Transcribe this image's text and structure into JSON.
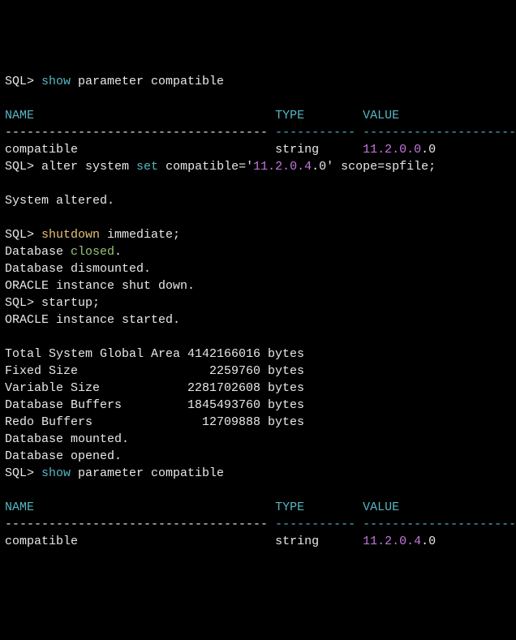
{
  "lines": {
    "cmd1_prompt": "SQL> ",
    "cmd1_keyword": "show",
    "cmd1_rest": " parameter compatible",
    "blank1": "",
    "hdr1_name": "NAME                                 ",
    "hdr1_type": "TYPE        ",
    "hdr1_value": "VALUE",
    "dash1a": "------------------------------------ ",
    "dash1b": "----------- ",
    "dash1c": "------------------------------",
    "row1_name": "compatible                           ",
    "row1_type": "string      ",
    "row1_val_a": "11.2.0.0",
    "row1_val_b": ".0",
    "cmd2_prompt": "SQL> ",
    "cmd2_a": "alter system ",
    "cmd2_b": "set",
    "cmd2_c": " compatible=",
    "cmd2_q1": "'",
    "cmd2_val": "11.2.0.4",
    "cmd2_valrest": ".0",
    "cmd2_q2": "'",
    "cmd2_d": " scope=spfile;",
    "blank2": "",
    "sysaltered": "System altered.",
    "blank3": "",
    "cmd3_prompt": "SQL> ",
    "cmd3_a": "shutdown",
    "cmd3_b": " immediate;",
    "db_closed_a": "Database ",
    "db_closed_b": "closed",
    "db_closed_c": ".",
    "db_dism": "Database dismounted.",
    "inst_shut": "ORACLE instance shut down.",
    "cmd4_prompt": "SQL> ",
    "cmd4_a": "startup;",
    "inst_started": "ORACLE instance started.",
    "blank4": "",
    "sga": "Total System Global Area 4142166016 bytes",
    "fixed": "Fixed Size                  2259760 bytes",
    "var": "Variable Size            2281702608 bytes",
    "buf": "Database Buffers         1845493760 bytes",
    "redo": "Redo Buffers               12709888 bytes",
    "dbmounted": "Database mounted.",
    "dbopened": "Database opened.",
    "cmd5_prompt": "SQL> ",
    "cmd5_keyword": "show",
    "cmd5_rest": " parameter compatible",
    "blank5": "",
    "hdr2_name": "NAME                                 ",
    "hdr2_type": "TYPE        ",
    "hdr2_value": "VALUE",
    "dash2a": "------------------------------------ ",
    "dash2b": "----------- ",
    "dash2c": "------------------------------",
    "row2_name": "compatible                           ",
    "row2_type": "string      ",
    "row2_val_a": "11.2.0.4",
    "row2_val_b": ".0"
  }
}
